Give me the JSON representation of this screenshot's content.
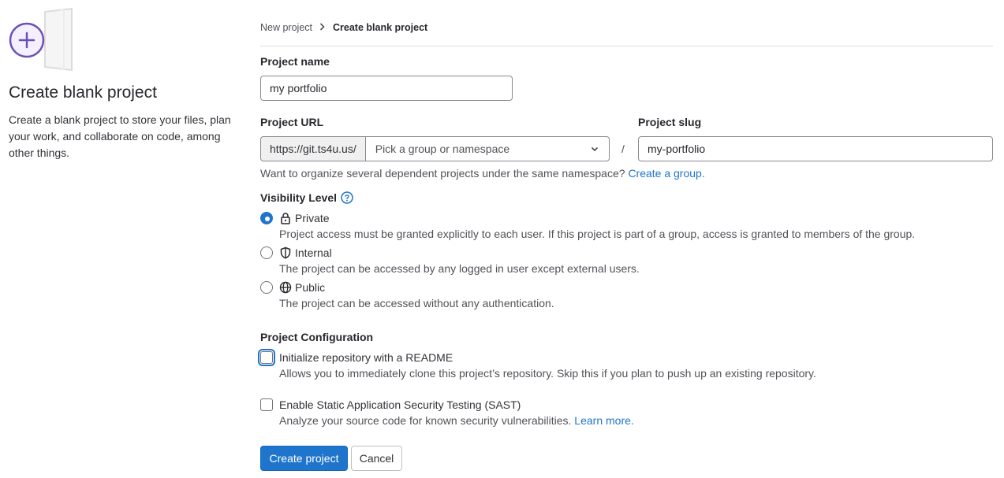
{
  "sidebar": {
    "title": "Create blank project",
    "description": "Create a blank project to store your files, plan your work, and collaborate on code, among other things."
  },
  "breadcrumb": {
    "parent": "New project",
    "current": "Create blank project"
  },
  "project_name": {
    "label": "Project name",
    "value": "my portfolio"
  },
  "project_url": {
    "label": "Project URL",
    "prefix": "https://git.ts4u.us/",
    "namespace_placeholder": "Pick a group or namespace",
    "separator": "/"
  },
  "project_slug": {
    "label": "Project slug",
    "value": "my-portfolio"
  },
  "group_help": {
    "text": "Want to organize several dependent projects under the same namespace?",
    "link": "Create a group."
  },
  "visibility": {
    "label": "Visibility Level",
    "options": [
      {
        "label": "Private",
        "icon": "lock-icon",
        "selected": true,
        "description": "Project access must be granted explicitly to each user. If this project is part of a group, access is granted to members of the group."
      },
      {
        "label": "Internal",
        "icon": "shield-icon",
        "selected": false,
        "description": "The project can be accessed by any logged in user except external users."
      },
      {
        "label": "Public",
        "icon": "globe-icon",
        "selected": false,
        "description": "The project can be accessed without any authentication."
      }
    ]
  },
  "configuration": {
    "label": "Project Configuration",
    "readme": {
      "label": "Initialize repository with a README",
      "checked": false,
      "description": "Allows you to immediately clone this project’s repository. Skip this if you plan to push up an existing repository."
    },
    "sast": {
      "label": "Enable Static Application Security Testing (SAST)",
      "checked": false,
      "description": "Analyze your source code for known security vulnerabilities.",
      "link": "Learn more."
    }
  },
  "actions": {
    "create": "Create project",
    "cancel": "Cancel"
  },
  "colors": {
    "primary": "#1f75cb",
    "illustration_accent": "#6b4fbb"
  }
}
